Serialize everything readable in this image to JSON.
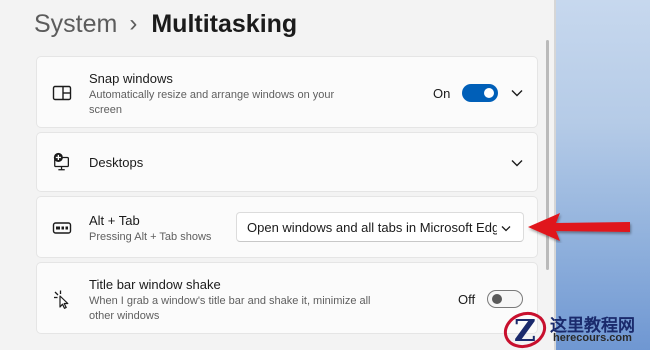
{
  "breadcrumb": {
    "parent": "System",
    "separator": "›",
    "current": "Multitasking"
  },
  "settings": {
    "snap_windows": {
      "title": "Snap windows",
      "description": "Automatically resize and arrange windows on your screen",
      "toggle_state": "On",
      "toggle_on": true,
      "icon": "snap-layout-icon"
    },
    "desktops": {
      "title": "Desktops",
      "icon": "virtual-desktop-icon"
    },
    "alt_tab": {
      "title": "Alt + Tab",
      "description": "Pressing Alt + Tab shows",
      "selected_option": "Open windows and all tabs in Microsoft Edge",
      "icon": "alt-tab-icon"
    },
    "title_bar_shake": {
      "title": "Title bar window shake",
      "description": "When I grab a window's title bar and shake it, minimize all other windows",
      "toggle_state": "Off",
      "toggle_on": false,
      "icon": "shake-cursor-icon"
    }
  },
  "colors": {
    "accent": "#005fb8",
    "annotation_arrow": "#e0141b"
  },
  "watermark": {
    "title": "这里教程网",
    "url": "herecours.com"
  }
}
